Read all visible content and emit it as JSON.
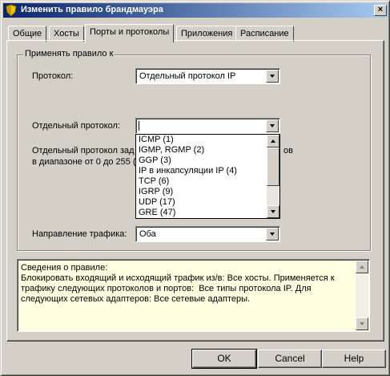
{
  "window": {
    "title": "Изменить правило брандмауэра",
    "close_glyph": "×",
    "icon": "firewall-shield-icon"
  },
  "tabs": [
    {
      "label": "Общие",
      "active": false
    },
    {
      "label": "Хосты",
      "active": false
    },
    {
      "label": "Порты и протоколы",
      "active": true
    },
    {
      "label": "Приложения",
      "active": false
    },
    {
      "label": "Расписание",
      "active": false
    }
  ],
  "group": {
    "legend": "Применять правило к"
  },
  "protocol": {
    "label": "Протокол:",
    "value": "Отдельный протокол IP"
  },
  "single_protocol": {
    "label": "Отдельный протокол:",
    "value": "",
    "hint_line1": "Отдельный протокол зад",
    "hint_line1_end": "ов",
    "hint_line2": "в диапазоне от 0 до 255 ("
  },
  "dropdown": {
    "options": [
      "ICMP (1)",
      "IGMP, RGMP (2)",
      "GGP (3)",
      "IP в инкапсуляции IP (4)",
      "TCP (6)",
      "IGRP (9)",
      "UDP (17)",
      "GRE (47)"
    ]
  },
  "direction": {
    "label": "Направление трафика:",
    "value": "Оба"
  },
  "info": {
    "text": "Сведения о правиле:\nБлокировать входящий и исходящий трафик из/в: Все хосты. Применяется к трафику следующих протоколов и портов:  Все типы протокола IP. Для следующих сетевых адаптеров: Все сетевые адаптеры."
  },
  "buttons": {
    "ok": "OK",
    "cancel": "Cancel",
    "help": "Help"
  },
  "colors": {
    "title_gradient_start": "#0a246a",
    "title_gradient_end": "#a6caf0",
    "face": "#d4d0c8",
    "info_background": "#ffffe1"
  }
}
